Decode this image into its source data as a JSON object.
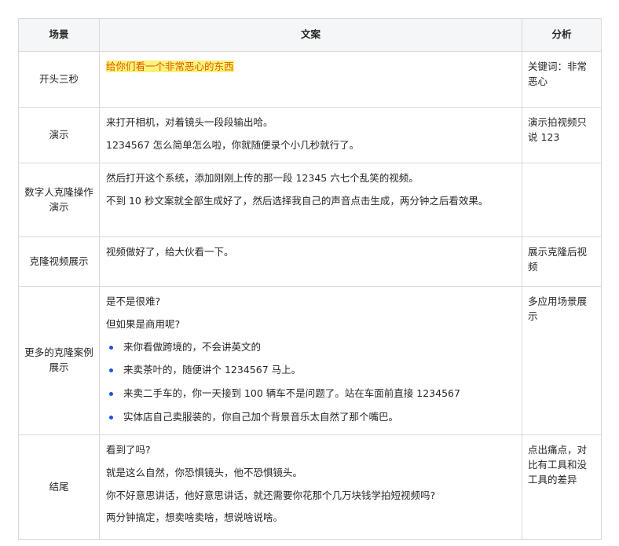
{
  "header": {
    "col_scene": "场景",
    "col_copy": "文案",
    "col_analysis": "分析"
  },
  "rows": [
    {
      "scene": "开头三秒",
      "copy": [
        "给你们看一个非常恶心的东西"
      ],
      "analysis": "关键词：非常恶心"
    },
    {
      "scene": "演示",
      "copy": [
        "来打开相机，对着镜头一段段输出哈。",
        "1234567 怎么简单怎么啦，你就随便录个小几秒就行了。"
      ],
      "analysis": "演示拍视频只说 123"
    },
    {
      "scene": "数字人克隆操作演示",
      "copy": [
        "然后打开这个系统，添加刚刚上传的那一段 12345 六七个乱笑的视频。",
        "不到 10 秒文案就全部生成好了，然后选择我自己的声音点击生成，两分钟之后看效果。"
      ],
      "analysis": ""
    },
    {
      "scene": "克隆视频展示",
      "copy": [
        "视频做好了，给大伙看一下。"
      ],
      "analysis": "展示克隆后视频"
    },
    {
      "scene": "更多的克隆案例展示",
      "copy": [
        "是不是很难?",
        "但如果是商用呢?"
      ],
      "bullets": [
        "来你看做跨境的，不会讲英文的",
        "来卖茶叶的，随便讲个 1234567 马上。",
        "来卖二手车的，你一天接到 100 辆车不是问题了。站在车面前直接 1234567",
        "实体店自己卖服装的，你自己加个背景音乐太自然了那个嘴巴。"
      ],
      "analysis": "多应用场景展示"
    },
    {
      "scene": "结尾",
      "copy": [
        "看到了吗?",
        "就是这么自然，你恐惧镜头，他不恐惧镜头。",
        "你不好意思讲话，他好意思讲话，就还需要你花那个几万块钱学拍短视频吗?",
        "两分钟搞定，想卖啥卖啥，想说啥说啥。"
      ],
      "analysis": "点出痛点，对比有工具和没工具的差异"
    }
  ],
  "colors": {
    "highlight_bg": "#fdf27a",
    "highlight_text": "#e05a00",
    "bullet": "#1a56db",
    "header_bg": "#f5f6f7",
    "border": "#d9d9d9"
  }
}
